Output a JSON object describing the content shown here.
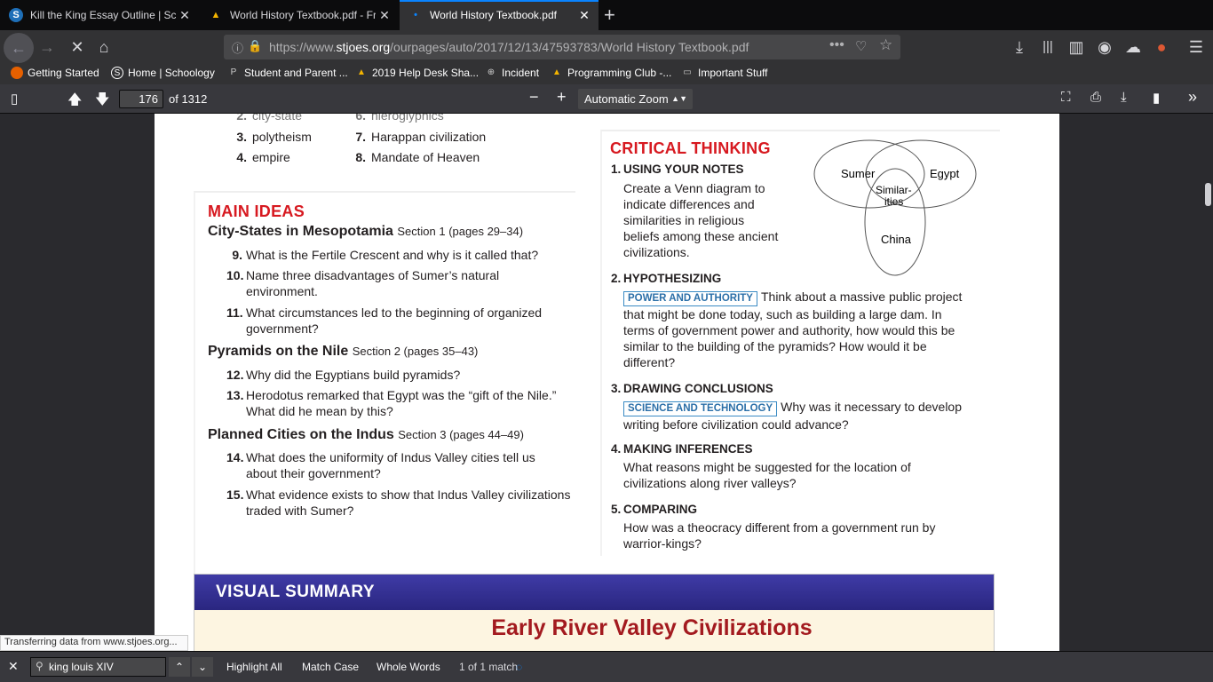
{
  "tabs": [
    {
      "title": "Kill the King Essay Outline | Sch",
      "fav": "S",
      "fav_color": "#1e6fb8",
      "active": false
    },
    {
      "title": "World History Textbook.pdf - Fr",
      "fav": "▲",
      "fav_color": "#f4b400",
      "active": false
    },
    {
      "title": "World History Textbook.pdf",
      "fav": "•",
      "fav_color": "#0a84ff",
      "active": true
    }
  ],
  "newtab": "+",
  "nav": {
    "url_prefix": "https://www.",
    "url_domain": "stjoes.org",
    "url_path": "/ourpages/auto/2017/12/13/47593783/World History Textbook.pdf"
  },
  "bookmarks": [
    {
      "label": "Getting Started",
      "icon": "●",
      "color": "#e66000"
    },
    {
      "label": "Home | Schoology",
      "icon": "S",
      "color": "#1e6fb8"
    },
    {
      "label": "Student and Parent ...",
      "icon": "P",
      "color": "#888"
    },
    {
      "label": "2019 Help Desk Sha...",
      "icon": "▲",
      "color": "#f4b400"
    },
    {
      "label": "Incident",
      "icon": "⊕",
      "color": "#aaa"
    },
    {
      "label": "Programming Club -...",
      "icon": "▲",
      "color": "#f4b400"
    },
    {
      "label": "Important Stuff",
      "icon": "▭",
      "color": "#aaa"
    }
  ],
  "pdf": {
    "page": "176",
    "of": "of 1312",
    "zoom": "Automatic Zoom"
  },
  "vocab": [
    {
      "n": "3.",
      "t": "polytheism"
    },
    {
      "n": "4.",
      "t": "empire"
    },
    {
      "n": "7.",
      "t": "Harappan civilization"
    },
    {
      "n": "8.",
      "t": "Mandate of Heaven"
    }
  ],
  "vocab_cut": [
    "city-state",
    "hieroglyphics"
  ],
  "main_ideas": {
    "title": "MAIN IDEAS",
    "sections": [
      {
        "head": "City-States in Mesopotamia",
        "ref": "Section 1 (pages 29–34)"
      },
      {
        "head": "Pyramids on the Nile",
        "ref": "Section 2 (pages 35–43)"
      },
      {
        "head": "Planned Cities on the Indus",
        "ref": "Section 3 (pages 44–49)"
      }
    ],
    "questions": [
      {
        "n": "9.",
        "t": "What is the Fertile Crescent and why is it called that?"
      },
      {
        "n": "10.",
        "t": "Name three disadvantages of Sumer’s natural environment."
      },
      {
        "n": "11.",
        "t": "What circumstances led to the beginning of organized government?"
      },
      {
        "n": "12.",
        "t": "Why did the Egyptians build pyramids?"
      },
      {
        "n": "13.",
        "t": "Herodotus remarked that Egypt was the “gift of the Nile.” What did he mean by this?"
      },
      {
        "n": "14.",
        "t": "What does the uniformity of Indus Valley cities tell us about their government?"
      },
      {
        "n": "15.",
        "t": "What evidence exists to show that Indus Valley civilizations traded with Sumer?"
      }
    ]
  },
  "critical": {
    "title": "CRITICAL THINKING",
    "items": [
      {
        "n": "1.",
        "head": "USING YOUR NOTES",
        "tag": "",
        "text": "Create a Venn diagram to indicate differences and similarities in religious beliefs among these ancient civilizations."
      },
      {
        "n": "2.",
        "head": "HYPOTHESIZING",
        "tag": "POWER AND AUTHORITY",
        "text": "Think about a massive public project that might be done today, such as building a large dam. In terms of government power and authority, how would this be similar to the building of the pyramids? How would it be different?"
      },
      {
        "n": "3.",
        "head": "DRAWING CONCLUSIONS",
        "tag": "SCIENCE AND TECHNOLOGY",
        "text": "Why was it necessary to develop writing before civilization could advance?"
      },
      {
        "n": "4.",
        "head": "MAKING INFERENCES",
        "tag": "",
        "text": "What reasons might be suggested for the location of civilizations along river valleys?"
      },
      {
        "n": "5.",
        "head": "COMPARING",
        "tag": "",
        "text": "How was a theocracy different from a government run by warrior-kings?"
      }
    ],
    "venn": {
      "a": "Sumer",
      "b": "Egypt",
      "c": "China",
      "mid1": "Similar-",
      "mid2": "ities"
    }
  },
  "visual_summary": {
    "head": "VISUAL SUMMARY",
    "title": "Early River Valley Civilizations"
  },
  "status": "Transferring data from www.stjoes.org...",
  "find": {
    "query": "king louis XIV",
    "highlight_all": "Highlight All",
    "match_case": "Match Case",
    "whole_words": "Whole Words",
    "result": "1 of 1 match"
  }
}
